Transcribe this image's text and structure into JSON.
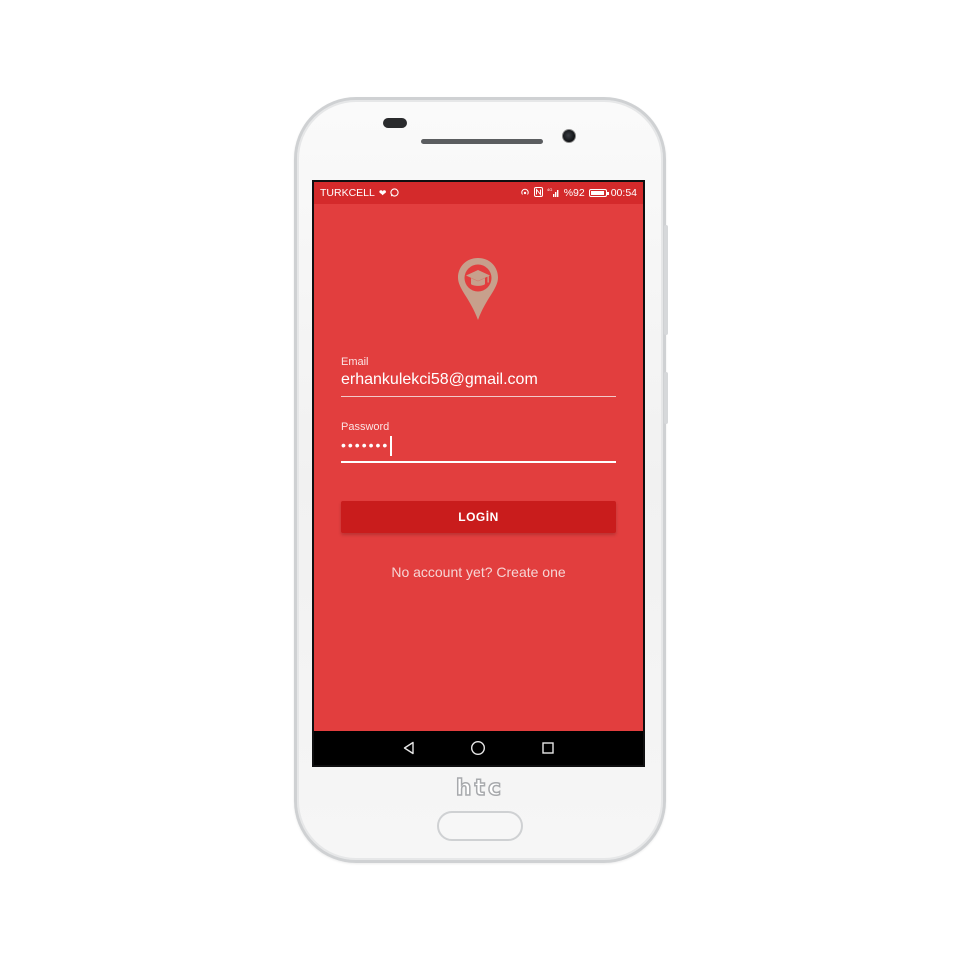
{
  "device": {
    "brand": "htc"
  },
  "statusbar": {
    "carrier": "TURKCELL",
    "battery_percent": "%92",
    "battery_level": 0.92,
    "time": "00:54",
    "network": "4G"
  },
  "app": {
    "background_color": "#e23e3e",
    "logo": "graduation-cap-location-pin-icon",
    "email": {
      "label": "Email",
      "value": "erhankulekci58@gmail.com"
    },
    "password": {
      "label": "Password",
      "masked_value": "•••••••"
    },
    "login_button": {
      "label": "LOGİN",
      "color": "#c91c1c"
    },
    "create_account_link": "No account yet? Create one"
  },
  "navbar": {
    "buttons": [
      "back-icon",
      "home-icon",
      "recents-icon"
    ]
  }
}
